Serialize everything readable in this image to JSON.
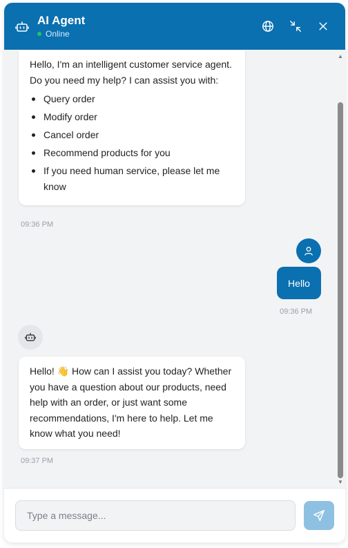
{
  "header": {
    "title": "AI Agent",
    "status": "Online",
    "status_color": "#22c55e",
    "background": "#0a70b0",
    "buttons": [
      {
        "icon": "globe-icon"
      },
      {
        "icon": "minimize-icon"
      },
      {
        "icon": "close-icon"
      }
    ]
  },
  "messages": [
    {
      "sender": "bot",
      "intro_line1": "Hello, I'm an intelligent customer service agent.",
      "intro_line2": "Do you need my help? I can assist you with:",
      "items": [
        "Query order",
        "Modify order",
        "Cancel order",
        "Recommend products for you",
        "If you need human service, please let me know"
      ],
      "time": "09:36 PM"
    },
    {
      "sender": "user",
      "text": "Hello",
      "time": "09:36 PM"
    },
    {
      "sender": "bot",
      "text": "Hello! 👋 How can I assist you today? Whether you have a question about our products, need help with an order, or just want some recommendations, I'm here to help. Let me know what you need!",
      "time": "09:37 PM"
    }
  ],
  "composer": {
    "placeholder": "Type a message...",
    "value": "",
    "send_icon": "send-icon",
    "send_color": "#8ec0e2"
  }
}
